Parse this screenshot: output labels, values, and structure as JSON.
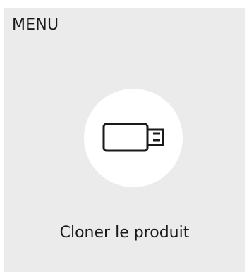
{
  "menu": {
    "title": "MENU"
  },
  "item": {
    "label": "Cloner le produit",
    "icon": "usb-drive-icon"
  },
  "colors": {
    "panel_background": "#ebebeb",
    "tile_background": "#ffffff",
    "text": "#1a1a1a",
    "icon_stroke": "#1a1a1a"
  }
}
